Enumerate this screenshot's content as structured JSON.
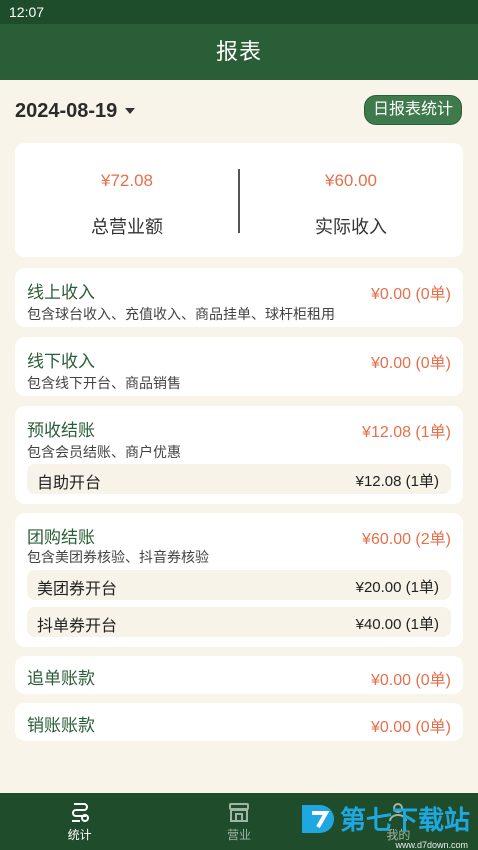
{
  "status_bar": {
    "time": "12:07"
  },
  "app_bar": {
    "title": "报表"
  },
  "toolbar": {
    "date": "2024-08-19",
    "daily_stats_label": "日报表统计"
  },
  "summary": {
    "total_amount": "¥72.08",
    "total_label": "总营业额",
    "actual_amount": "¥60.00",
    "actual_label": "实际收入"
  },
  "sections": {
    "online": {
      "title": "线上收入",
      "amount": "¥0.00 (0单)",
      "desc": "包含球台收入、充值收入、商品挂单、球杆柜租用"
    },
    "offline": {
      "title": "线下收入",
      "amount": "¥0.00 (0单)",
      "desc": "包含线下开台、商品销售"
    },
    "prepaid": {
      "title": "预收结账",
      "amount": "¥12.08 (1单)",
      "desc": "包含会员结账、商户优惠",
      "items": [
        {
          "label": "自助开台",
          "amount": "¥12.08 (1单)"
        }
      ]
    },
    "group": {
      "title": "团购结账",
      "amount": "¥60.00 (2单)",
      "desc": "包含美团券核验、抖音券核验",
      "items": [
        {
          "label": "美团券开台",
          "amount": "¥20.00 (1单)"
        },
        {
          "label": "抖单券开台",
          "amount": "¥40.00 (1单)"
        }
      ]
    },
    "followup": {
      "title": "追单账款",
      "amount": "¥0.00 (0单)"
    },
    "writeoff": {
      "title": "销账账款",
      "amount": "¥0.00 (0单)"
    }
  },
  "tabs": [
    {
      "label": "统计",
      "icon": "stats-icon",
      "active": true
    },
    {
      "label": "营业",
      "icon": "store-icon",
      "active": false
    },
    {
      "label": "我的",
      "icon": "user-icon",
      "active": false
    }
  ],
  "watermark": {
    "brand": "第七下载站",
    "url": "www.d7down.com"
  },
  "colors": {
    "primary": "#2a5e37",
    "accent": "#e5704b",
    "background": "#f8f4ea"
  }
}
